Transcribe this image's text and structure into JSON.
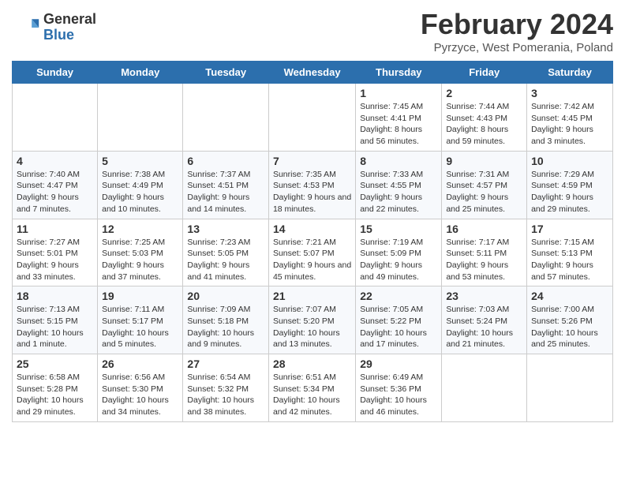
{
  "header": {
    "logo_general": "General",
    "logo_blue": "Blue",
    "month_year": "February 2024",
    "location": "Pyrzyce, West Pomerania, Poland"
  },
  "days_of_week": [
    "Sunday",
    "Monday",
    "Tuesday",
    "Wednesday",
    "Thursday",
    "Friday",
    "Saturday"
  ],
  "weeks": [
    [
      {
        "day": "",
        "info": ""
      },
      {
        "day": "",
        "info": ""
      },
      {
        "day": "",
        "info": ""
      },
      {
        "day": "",
        "info": ""
      },
      {
        "day": "1",
        "info": "Sunrise: 7:45 AM\nSunset: 4:41 PM\nDaylight: 8 hours and 56 minutes."
      },
      {
        "day": "2",
        "info": "Sunrise: 7:44 AM\nSunset: 4:43 PM\nDaylight: 8 hours and 59 minutes."
      },
      {
        "day": "3",
        "info": "Sunrise: 7:42 AM\nSunset: 4:45 PM\nDaylight: 9 hours and 3 minutes."
      }
    ],
    [
      {
        "day": "4",
        "info": "Sunrise: 7:40 AM\nSunset: 4:47 PM\nDaylight: 9 hours and 7 minutes."
      },
      {
        "day": "5",
        "info": "Sunrise: 7:38 AM\nSunset: 4:49 PM\nDaylight: 9 hours and 10 minutes."
      },
      {
        "day": "6",
        "info": "Sunrise: 7:37 AM\nSunset: 4:51 PM\nDaylight: 9 hours and 14 minutes."
      },
      {
        "day": "7",
        "info": "Sunrise: 7:35 AM\nSunset: 4:53 PM\nDaylight: 9 hours and 18 minutes."
      },
      {
        "day": "8",
        "info": "Sunrise: 7:33 AM\nSunset: 4:55 PM\nDaylight: 9 hours and 22 minutes."
      },
      {
        "day": "9",
        "info": "Sunrise: 7:31 AM\nSunset: 4:57 PM\nDaylight: 9 hours and 25 minutes."
      },
      {
        "day": "10",
        "info": "Sunrise: 7:29 AM\nSunset: 4:59 PM\nDaylight: 9 hours and 29 minutes."
      }
    ],
    [
      {
        "day": "11",
        "info": "Sunrise: 7:27 AM\nSunset: 5:01 PM\nDaylight: 9 hours and 33 minutes."
      },
      {
        "day": "12",
        "info": "Sunrise: 7:25 AM\nSunset: 5:03 PM\nDaylight: 9 hours and 37 minutes."
      },
      {
        "day": "13",
        "info": "Sunrise: 7:23 AM\nSunset: 5:05 PM\nDaylight: 9 hours and 41 minutes."
      },
      {
        "day": "14",
        "info": "Sunrise: 7:21 AM\nSunset: 5:07 PM\nDaylight: 9 hours and 45 minutes."
      },
      {
        "day": "15",
        "info": "Sunrise: 7:19 AM\nSunset: 5:09 PM\nDaylight: 9 hours and 49 minutes."
      },
      {
        "day": "16",
        "info": "Sunrise: 7:17 AM\nSunset: 5:11 PM\nDaylight: 9 hours and 53 minutes."
      },
      {
        "day": "17",
        "info": "Sunrise: 7:15 AM\nSunset: 5:13 PM\nDaylight: 9 hours and 57 minutes."
      }
    ],
    [
      {
        "day": "18",
        "info": "Sunrise: 7:13 AM\nSunset: 5:15 PM\nDaylight: 10 hours and 1 minute."
      },
      {
        "day": "19",
        "info": "Sunrise: 7:11 AM\nSunset: 5:17 PM\nDaylight: 10 hours and 5 minutes."
      },
      {
        "day": "20",
        "info": "Sunrise: 7:09 AM\nSunset: 5:18 PM\nDaylight: 10 hours and 9 minutes."
      },
      {
        "day": "21",
        "info": "Sunrise: 7:07 AM\nSunset: 5:20 PM\nDaylight: 10 hours and 13 minutes."
      },
      {
        "day": "22",
        "info": "Sunrise: 7:05 AM\nSunset: 5:22 PM\nDaylight: 10 hours and 17 minutes."
      },
      {
        "day": "23",
        "info": "Sunrise: 7:03 AM\nSunset: 5:24 PM\nDaylight: 10 hours and 21 minutes."
      },
      {
        "day": "24",
        "info": "Sunrise: 7:00 AM\nSunset: 5:26 PM\nDaylight: 10 hours and 25 minutes."
      }
    ],
    [
      {
        "day": "25",
        "info": "Sunrise: 6:58 AM\nSunset: 5:28 PM\nDaylight: 10 hours and 29 minutes."
      },
      {
        "day": "26",
        "info": "Sunrise: 6:56 AM\nSunset: 5:30 PM\nDaylight: 10 hours and 34 minutes."
      },
      {
        "day": "27",
        "info": "Sunrise: 6:54 AM\nSunset: 5:32 PM\nDaylight: 10 hours and 38 minutes."
      },
      {
        "day": "28",
        "info": "Sunrise: 6:51 AM\nSunset: 5:34 PM\nDaylight: 10 hours and 42 minutes."
      },
      {
        "day": "29",
        "info": "Sunrise: 6:49 AM\nSunset: 5:36 PM\nDaylight: 10 hours and 46 minutes."
      },
      {
        "day": "",
        "info": ""
      },
      {
        "day": "",
        "info": ""
      }
    ]
  ]
}
